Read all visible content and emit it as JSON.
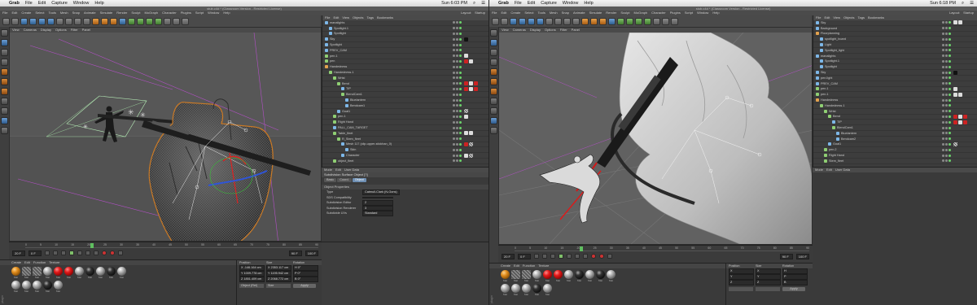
{
  "left": {
    "macbar": {
      "apple": "",
      "app": "Grab",
      "menus": [
        "File",
        "Edit",
        "Capture",
        "Window",
        "Help"
      ],
      "clock": "Sun 6:03 PM"
    },
    "window_title": "stub.c4d * (Classroom Version - Restricted License)",
    "c4d_menus": [
      "File",
      "Edit",
      "Create",
      "Select",
      "Tools",
      "Mesh",
      "Snap",
      "Animate",
      "Simulate",
      "Render",
      "Sculpt",
      "MoGraph",
      "Character",
      "Plugins",
      "Script",
      "Window",
      "Help"
    ],
    "layout_tabs": [
      "Layout:",
      "Startup"
    ],
    "viewport_menu": [
      "View",
      "Cameras",
      "Display",
      "Options",
      "Filter",
      "Panel"
    ],
    "objmgr_menu": [
      "File",
      "Edit",
      "View",
      "Objects",
      "Tags",
      "Bookmarks"
    ],
    "objects": [
      {
        "name": "manalights",
        "indent": 0,
        "icon": "blue",
        "tags": []
      },
      {
        "name": "Spotlight.1",
        "indent": 1,
        "icon": "blue",
        "tags": []
      },
      {
        "name": "Spotlight",
        "indent": 1,
        "icon": "blue",
        "tags": []
      },
      {
        "name": "Sky",
        "indent": 0,
        "icon": "blue",
        "tags": [
          "dark"
        ]
      },
      {
        "name": "Spotlight",
        "indent": 0,
        "icon": "blue",
        "tags": []
      },
      {
        "name": "PREV_CAM",
        "indent": 0,
        "icon": "blue",
        "tags": []
      },
      {
        "name": "pen.1",
        "indent": 0,
        "icon": "green",
        "tags": [
          "white"
        ]
      },
      {
        "name": "pen",
        "indent": 0,
        "icon": "green",
        "tags": [
          "red",
          "white"
        ]
      },
      {
        "name": "Handedness",
        "indent": 0,
        "icon": "orange",
        "tags": []
      },
      {
        "name": "Handedness.1",
        "indent": 1,
        "icon": "green",
        "tags": []
      },
      {
        "name": "Wrist",
        "indent": 2,
        "icon": "green",
        "tags": []
      },
      {
        "name": "Bend",
        "indent": 3,
        "icon": "green",
        "tags": [
          "red",
          "white",
          "red"
        ]
      },
      {
        "name": "TIP",
        "indent": 4,
        "icon": "blue",
        "tags": [
          "red",
          "white",
          "red"
        ]
      },
      {
        "name": "BlendCam1",
        "indent": 4,
        "icon": "green",
        "tags": []
      },
      {
        "name": "Bluelantern",
        "indent": 5,
        "icon": "blue",
        "tags": []
      },
      {
        "name": "Bendcam1",
        "indent": 5,
        "icon": "blue",
        "tags": []
      },
      {
        "name": "Goal1",
        "indent": 3,
        "icon": "blue",
        "tags": [
          "chk"
        ]
      },
      {
        "name": "pen.1",
        "indent": 2,
        "icon": "green",
        "tags": [
          "white"
        ]
      },
      {
        "name": "Right Hand",
        "indent": 2,
        "icon": "green",
        "tags": []
      },
      {
        "name": "PALL_CAM_TARGET",
        "indent": 2,
        "icon": "blue",
        "tags": []
      },
      {
        "name": "Table_fleet",
        "indent": 2,
        "icon": "green",
        "tags": [
          "white",
          "white"
        ]
      },
      {
        "name": "R_Stem_fleet",
        "indent": 3,
        "icon": "green",
        "tags": []
      },
      {
        "name": "Mesh 117 (clip-upper-stickhan_0)",
        "indent": 4,
        "icon": "blue",
        "tags": [
          "red",
          "chk"
        ]
      },
      {
        "name": "Skin",
        "indent": 5,
        "icon": "blue",
        "tags": []
      },
      {
        "name": "Character",
        "indent": 4,
        "icon": "blue",
        "tags": [
          "white",
          "chk"
        ]
      },
      {
        "name": "object_fleet",
        "indent": 2,
        "icon": "green",
        "tags": []
      }
    ],
    "attr": {
      "menu": [
        "Mode",
        "Edit",
        "User Data"
      ],
      "title": "Subdivision Surface Object [?]",
      "tabs": [
        "Basic",
        "Coord.",
        "Object"
      ],
      "active_tab": "Object",
      "section": "Object Properties",
      "rows": [
        {
          "label": "Type",
          "value": "Catmull-Clark (N-Gons)"
        },
        {
          "label": "SDS Compatibility",
          "value": ""
        },
        {
          "label": "Subdivision Editor",
          "value": "2"
        },
        {
          "label": "Subdivision Renderer",
          "value": "3"
        },
        {
          "label": "Subdivide UVs",
          "value": "Standard"
        }
      ]
    },
    "timeline": {
      "ticks": [
        "0",
        "5",
        "10",
        "15",
        "20",
        "25",
        "30",
        "35",
        "40",
        "45",
        "50",
        "55",
        "60",
        "65",
        "70",
        "75",
        "80",
        "85",
        "90"
      ],
      "playhead_frame": 20,
      "start_field": "20 F",
      "start_field2": "0 F",
      "end_field": "90 F",
      "end_field2": "100 F"
    },
    "materials_menu": [
      "Create",
      "Edit",
      "Function",
      "Texture"
    ],
    "materials": [
      {
        "style": "orange",
        "label": "Mat"
      },
      {
        "style": "striped",
        "label": "Mat"
      },
      {
        "style": "striped",
        "label": "Mat"
      },
      {
        "style": "plain",
        "label": "Mat"
      },
      {
        "style": "red",
        "label": "Mat"
      },
      {
        "style": "red",
        "label": "Mat"
      },
      {
        "style": "plain",
        "label": "Mat"
      },
      {
        "style": "dark",
        "label": "Mat"
      },
      {
        "style": "plain",
        "label": "Mat"
      },
      {
        "style": "dark",
        "label": "Mat"
      },
      {
        "style": "plain",
        "label": "Mat"
      },
      {
        "style": "plain",
        "label": "Mat"
      },
      {
        "style": "plain",
        "label": "Mat"
      },
      {
        "style": "plain",
        "label": "Mat"
      },
      {
        "style": "dark",
        "label": "Mat"
      },
      {
        "style": "plain",
        "label": "Mat"
      }
    ],
    "materials_logo": "plugin",
    "coords": {
      "headers": [
        "Position",
        "Size",
        "Rotation"
      ],
      "rows": [
        [
          "X  -146.164 cm",
          "X  2353.117 cm",
          "H  0°"
        ],
        [
          "Y  1009.778 cm",
          "Y  1195.942 cm",
          "P  0°"
        ],
        [
          "Z  1851.409 cm",
          "Z  2068.772 cm",
          "B  0°"
        ]
      ],
      "mode_select": "Object (Rel)",
      "size_select": "Size",
      "apply": "Apply"
    }
  },
  "right": {
    "macbar": {
      "apple": "",
      "app": "Grab",
      "menus": [
        "File",
        "Edit",
        "Capture",
        "Window",
        "Help"
      ],
      "clock": "Sun 6:18 PM"
    },
    "window_title": "stub.c4d * (Classroom Version - Restricted License)",
    "c4d_menus": [
      "File",
      "Edit",
      "Create",
      "Select",
      "Tools",
      "Mesh",
      "Snap",
      "Animate",
      "Simulate",
      "Render",
      "Sculpt",
      "MoGraph",
      "Character",
      "Plugins",
      "Script",
      "Window",
      "Help"
    ],
    "layout_tabs": [
      "Layout:",
      "Startup"
    ],
    "viewport_menu": [
      "View",
      "Cameras",
      "Display",
      "Options",
      "Filter",
      "Panel"
    ],
    "objmgr_menu": [
      "File",
      "Edit",
      "View",
      "Objects",
      "Tags",
      "Bookmarks"
    ],
    "objects": [
      {
        "name": "Sky",
        "indent": 0,
        "icon": "blue",
        "tags": [
          "white",
          "white"
        ]
      },
      {
        "name": "Background",
        "indent": 0,
        "icon": "blue",
        "tags": []
      },
      {
        "name": "Floorplanning",
        "indent": 0,
        "icon": "orange",
        "tags": []
      },
      {
        "name": "spotlight_board",
        "indent": 1,
        "icon": "blue",
        "tags": []
      },
      {
        "name": "Light",
        "indent": 1,
        "icon": "blue",
        "tags": []
      },
      {
        "name": "Spotlight_light",
        "indent": 1,
        "icon": "blue",
        "tags": []
      },
      {
        "name": "manalights",
        "indent": 0,
        "icon": "blue",
        "tags": []
      },
      {
        "name": "Spotlight.1",
        "indent": 1,
        "icon": "blue",
        "tags": []
      },
      {
        "name": "Spotlight",
        "indent": 1,
        "icon": "blue",
        "tags": []
      },
      {
        "name": "Sky",
        "indent": 0,
        "icon": "blue",
        "tags": [
          "dark"
        ]
      },
      {
        "name": "pen.light",
        "indent": 0,
        "icon": "blue",
        "tags": []
      },
      {
        "name": "PREV_CAM",
        "indent": 0,
        "icon": "blue",
        "tags": []
      },
      {
        "name": "pen.1",
        "indent": 0,
        "icon": "green",
        "tags": [
          "white"
        ]
      },
      {
        "name": "pen.1",
        "indent": 0,
        "icon": "green",
        "tags": [
          "white",
          "white"
        ]
      },
      {
        "name": "Handedness",
        "indent": 0,
        "icon": "orange",
        "tags": []
      },
      {
        "name": "Handedness.1",
        "indent": 1,
        "icon": "green",
        "tags": []
      },
      {
        "name": "Wrist",
        "indent": 2,
        "icon": "green",
        "tags": []
      },
      {
        "name": "Bend",
        "indent": 3,
        "icon": "green",
        "tags": [
          "red",
          "white",
          "red"
        ]
      },
      {
        "name": "TIP",
        "indent": 4,
        "icon": "blue",
        "tags": [
          "red",
          "white",
          "red"
        ]
      },
      {
        "name": "BlendCam1",
        "indent": 4,
        "icon": "green",
        "tags": []
      },
      {
        "name": "Bluelantern",
        "indent": 5,
        "icon": "blue",
        "tags": []
      },
      {
        "name": "Bendcam2",
        "indent": 5,
        "icon": "blue",
        "tags": []
      },
      {
        "name": "Goal1",
        "indent": 3,
        "icon": "blue",
        "tags": [
          "chk"
        ]
      },
      {
        "name": "pen.2",
        "indent": 2,
        "icon": "green",
        "tags": []
      },
      {
        "name": "Right Hand",
        "indent": 2,
        "icon": "green",
        "tags": []
      },
      {
        "name": "Stem_fleet",
        "indent": 2,
        "icon": "green",
        "tags": []
      }
    ],
    "attr": {
      "menu": [
        "Mode",
        "Edit",
        "User Data"
      ]
    },
    "timeline": {
      "ticks": [
        "0",
        "5",
        "10",
        "15",
        "20",
        "25",
        "30",
        "35",
        "40",
        "45",
        "50",
        "55",
        "60",
        "65",
        "70",
        "75",
        "80",
        "85",
        "90"
      ],
      "playhead_frame": 20,
      "start_field": "20 F",
      "start_field2": "0 F",
      "end_field": "90 F",
      "end_field2": "100 F"
    },
    "materials_menu": [
      "Create",
      "Edit",
      "Function",
      "Texture"
    ],
    "materials": [
      {
        "style": "orange",
        "label": "Mat"
      },
      {
        "style": "striped",
        "label": "Mat"
      },
      {
        "style": "striped",
        "label": "Mat"
      },
      {
        "style": "plain",
        "label": "Mat"
      },
      {
        "style": "red",
        "label": "Mat"
      },
      {
        "style": "red",
        "label": "Mat"
      },
      {
        "style": "plain",
        "label": "Mat"
      },
      {
        "style": "dark",
        "label": "Mat"
      },
      {
        "style": "plain",
        "label": "Mat"
      },
      {
        "style": "dark",
        "label": "Mat"
      },
      {
        "style": "plain",
        "label": "Mat"
      },
      {
        "style": "plain",
        "label": "Mat"
      },
      {
        "style": "plain",
        "label": "Mat"
      },
      {
        "style": "plain",
        "label": "Mat"
      },
      {
        "style": "dark",
        "label": "Mat"
      },
      {
        "style": "plain",
        "label": "Mat"
      }
    ],
    "materials_logo": "plugin",
    "coords": {
      "headers": [
        "Position",
        "Size",
        "Rotation"
      ],
      "rows": [
        [
          "X",
          "X",
          "H"
        ],
        [
          "Y",
          "Y",
          "P"
        ],
        [
          "Z",
          "Z",
          "B"
        ]
      ],
      "mode_select": "",
      "size_select": "",
      "apply": "Apply"
    }
  }
}
